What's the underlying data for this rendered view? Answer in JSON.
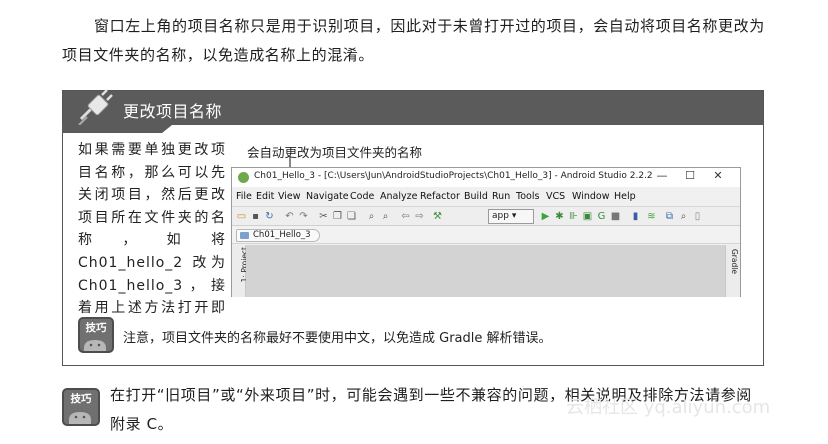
{
  "top_paragraph": "窗口左上角的项目名称只是用于识别项目，因此对于未曾打开过的项目，会自动将项目名称更改为项目文件夹的名称，以免造成名称上的混淆。",
  "tip": {
    "title": "更改项目名称",
    "side_text": "如果需要单独更改项目名称，那么可以先关闭项目，然后更改项目所在文件夹的名称，如将Ch01_hello_2 改为Ch01_hello_3，接着用上述方法打开即可。",
    "caption": "会自动更改为项目文件夹的名称",
    "note_icon_label": "技巧",
    "note_text": "注意，项目文件夹的名称最好不要使用中文，以免造成 Gradle 解析错误。"
  },
  "window": {
    "title": "Ch01_Hello_3 - [C:\\Users\\Jun\\AndroidStudioProjects\\Ch01_Hello_3] - Android Studio 2.2.2",
    "controls": [
      "—",
      "☐",
      "✕"
    ],
    "menus": [
      "File",
      "Edit",
      "View",
      "Navigate",
      "Code",
      "Analyze",
      "Refactor",
      "Build",
      "Run",
      "Tools",
      "VCS",
      "Window",
      "Help"
    ],
    "run_config": "app",
    "breadcrumb": "Ch01_Hello_3",
    "left_tool_window": "1: Project",
    "right_tool_window": "Gradle"
  },
  "bottom_paragraph": {
    "icon_label": "技巧",
    "text": "在打开“旧项目”或“外来项目”时，可能会遇到一些不兼容的问题，相关说明及排除方法请参阅附录 C。"
  },
  "watermark": "云栖社区 yq.aliyun.com",
  "colors": {
    "header_bg": "#5b5b5b",
    "workarea_bg": "#d3d3d3",
    "android_green": "#6fa84a"
  }
}
